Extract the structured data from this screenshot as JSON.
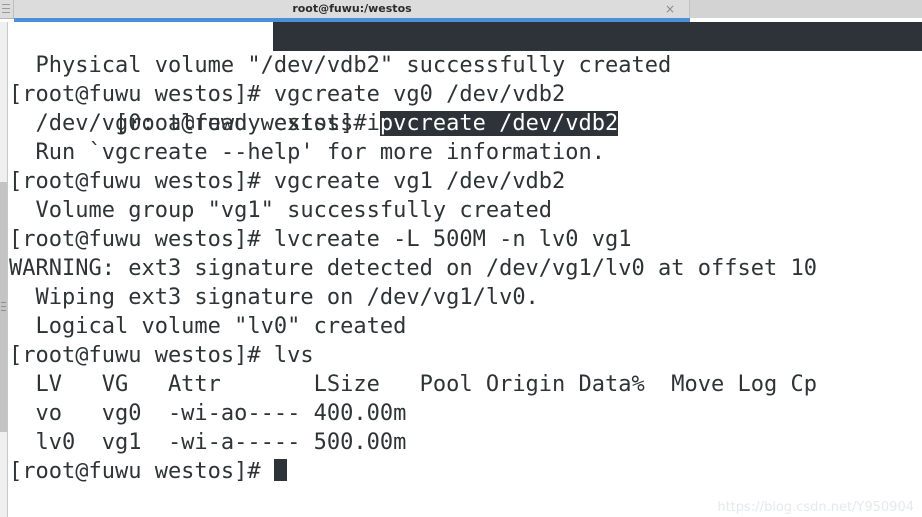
{
  "window": {
    "tab_title": "root@fuwu:/westos",
    "close_label": "×",
    "accent_color": "#4a90d9",
    "titlebar_color": "#d6d6d6"
  },
  "terminal": {
    "background_color": "#ffffff",
    "foreground_color": "#2e3436",
    "selection_background": "#2d3338",
    "selection_foreground": "#ffffff",
    "prompt": "[root@fuwu westos]# ",
    "lines": [
      {
        "prompt": "[root@fuwu westos]# ",
        "selected": "pvcreate /dev/vdb2",
        "type": "command-selected"
      },
      {
        "text": "  Physical volume \"/dev/vdb2\" successfully created",
        "type": "output"
      },
      {
        "text": "[root@fuwu westos]# vgcreate vg0 /dev/vdb2",
        "type": "command"
      },
      {
        "text": "  /dev/vg0: already exists in filesystem",
        "type": "output"
      },
      {
        "text": "  Run `vgcreate --help' for more information.",
        "type": "output"
      },
      {
        "text": "[root@fuwu westos]# vgcreate vg1 /dev/vdb2",
        "type": "command"
      },
      {
        "text": "  Volume group \"vg1\" successfully created",
        "type": "output"
      },
      {
        "text": "[root@fuwu westos]# lvcreate -L 500M -n lv0 vg1",
        "type": "command"
      },
      {
        "text": "WARNING: ext3 signature detected on /dev/vg1/lv0 at offset 10",
        "type": "output"
      },
      {
        "text": "  Wiping ext3 signature on /dev/vg1/lv0.",
        "type": "output"
      },
      {
        "text": "  Logical volume \"lv0\" created",
        "type": "output"
      },
      {
        "text": "[root@fuwu westos]# lvs",
        "type": "command"
      },
      {
        "text": "  LV   VG   Attr       LSize   Pool Origin Data%  Move Log Cp",
        "type": "output"
      },
      {
        "text": "  vo   vg0  -wi-ao---- 400.00m",
        "type": "output"
      },
      {
        "text": "  lv0  vg1  -wi-a----- 500.00m",
        "type": "output"
      },
      {
        "prompt": "[root@fuwu westos]# ",
        "cursor": true,
        "type": "prompt-cursor"
      }
    ],
    "lvs_table": {
      "headers": [
        "LV",
        "VG",
        "Attr",
        "LSize",
        "Pool",
        "Origin",
        "Data%",
        "Move",
        "Log",
        "Cp"
      ],
      "rows": [
        {
          "lv": "vo",
          "vg": "vg0",
          "attr": "-wi-ao----",
          "lsize": "400.00m"
        },
        {
          "lv": "lv0",
          "vg": "vg1",
          "attr": "-wi-a-----",
          "lsize": "500.00m"
        }
      ]
    }
  },
  "watermark": {
    "text": "https://blog.csdn.net/Y950904"
  }
}
